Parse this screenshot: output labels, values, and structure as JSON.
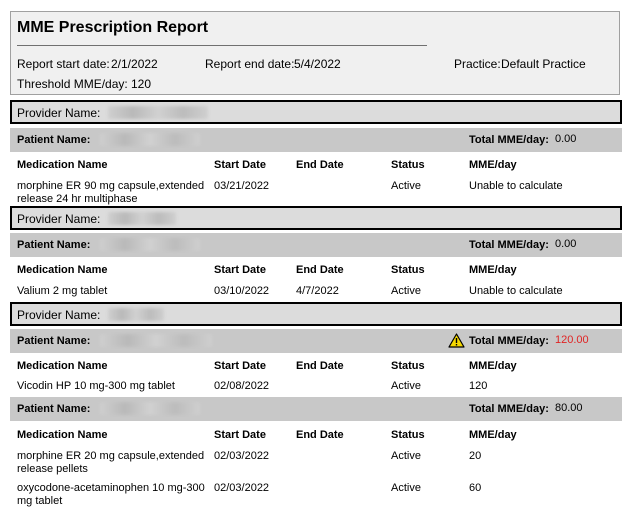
{
  "report": {
    "title": "MME Prescription Report",
    "start_label": "Report start date:",
    "start_value": "2/1/2022",
    "end_label": "Report end date:",
    "end_value": "5/4/2022",
    "practice_label": "Practice:",
    "practice_value": "Default Practice",
    "threshold_label": "Threshold MME/day:",
    "threshold_value": "120"
  },
  "labels": {
    "provider": "Provider Name:",
    "patient": "Patient Name:",
    "total": "Total MME/day:",
    "col_med": "Medication Name",
    "col_start": "Start Date",
    "col_end": "End Date",
    "col_status": "Status",
    "col_mme": "MME/day"
  },
  "sections": [
    {
      "patients": [
        {
          "total": "0.00",
          "warning": false,
          "meds": [
            {
              "name_line1": "morphine ER 90 mg capsule,extended",
              "name_line2": "release 24 hr multiphase",
              "start": "03/21/2022",
              "end": "",
              "status": "Active",
              "mme": "Unable to calculate"
            }
          ]
        }
      ]
    },
    {
      "patients": [
        {
          "total": "0.00",
          "warning": false,
          "meds": [
            {
              "name_line1": "Valium 2 mg tablet",
              "name_line2": "",
              "start": "03/10/2022",
              "end": "4/7/2022",
              "status": "Active",
              "mme": "Unable to calculate"
            }
          ]
        }
      ]
    },
    {
      "patients": [
        {
          "total": "120.00",
          "warning": true,
          "meds": [
            {
              "name_line1": "Vicodin HP 10 mg-300 mg tablet",
              "name_line2": "",
              "start": "02/08/2022",
              "end": "",
              "status": "Active",
              "mme": "120"
            }
          ]
        },
        {
          "total": "80.00",
          "warning": false,
          "meds": [
            {
              "name_line1": "morphine ER 20 mg capsule,extended",
              "name_line2": "release pellets",
              "start": "02/03/2022",
              "end": "",
              "status": "Active",
              "mme": "20"
            },
            {
              "name_line1": "oxycodone-acetaminophen 10 mg-300",
              "name_line2": "mg tablet",
              "start": "02/03/2022",
              "end": "",
              "status": "Active",
              "mme": "60"
            }
          ]
        }
      ]
    }
  ],
  "icons": {
    "warning": "warning-triangle-icon"
  },
  "colors": {
    "alert": "#e02424",
    "patient_band": "#c8c8c8",
    "provider_band": "#dcdcdc"
  }
}
